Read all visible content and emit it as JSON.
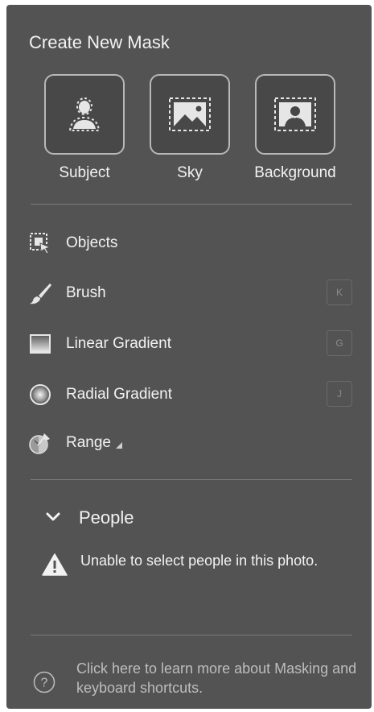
{
  "panel": {
    "title": "Create New Mask"
  },
  "quick_masks": [
    {
      "label": "Subject",
      "icon": "subject-icon"
    },
    {
      "label": "Sky",
      "icon": "sky-icon"
    },
    {
      "label": "Background",
      "icon": "background-icon"
    }
  ],
  "tools": [
    {
      "label": "Objects",
      "icon": "objects-icon",
      "shortcut": ""
    },
    {
      "label": "Brush",
      "icon": "brush-icon",
      "shortcut": "K"
    },
    {
      "label": "Linear Gradient",
      "icon": "linear-gradient-icon",
      "shortcut": "G"
    },
    {
      "label": "Radial Gradient",
      "icon": "radial-gradient-icon",
      "shortcut": "J"
    },
    {
      "label": "Range",
      "icon": "range-icon",
      "shortcut": ""
    }
  ],
  "people": {
    "label": "People",
    "message": "Unable to select people in this photo."
  },
  "help": {
    "text": "Click here to learn more about Masking and keyboard shortcuts."
  },
  "colors": {
    "panel_bg": "#535353",
    "text": "#f2f2f2",
    "muted_text": "#bdbdbd",
    "divider": "#7a7a7a"
  }
}
